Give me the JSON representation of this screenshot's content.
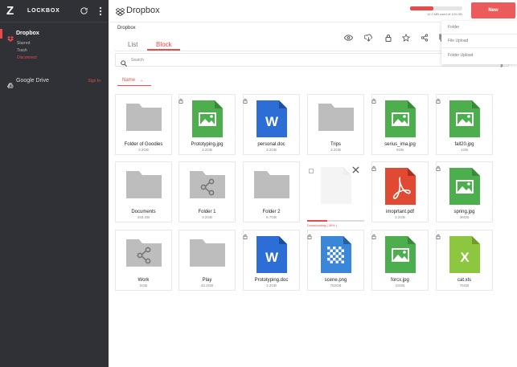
{
  "app": {
    "logo_letter": "Z",
    "brand": "LOCKBOX"
  },
  "sidebar": {
    "accounts": [
      {
        "name": "Dropbox",
        "subitems": [
          "Starred",
          "Trash"
        ],
        "action": "Disconnect"
      },
      {
        "name": "Google Drive",
        "action": "Sign In"
      }
    ]
  },
  "header": {
    "title": "Dropbox",
    "storage_text": "12.2 MB used of 100 GB",
    "storage_fraction": 0.45,
    "new_label": "New"
  },
  "new_menu": {
    "items": [
      "Folder",
      "File Upload",
      "Folder Upload"
    ]
  },
  "breadcrumb": "Dropbox",
  "tabs": [
    {
      "label": "List"
    },
    {
      "label": "Block"
    }
  ],
  "search": {
    "placeholder": "Search"
  },
  "sort": {
    "label": "Name"
  },
  "files": [
    {
      "name": "Folder of Goodies",
      "size": "3.2GB",
      "type": "folder"
    },
    {
      "name": "Prototyping.jpg",
      "size": "3.2GB",
      "type": "image"
    },
    {
      "name": "personal.doc",
      "size": "3.2GB",
      "type": "doc"
    },
    {
      "name": "Trips",
      "size": "3.2GB",
      "type": "folder"
    },
    {
      "name": "serius_ima.jpg",
      "size": "5GB",
      "type": "image"
    },
    {
      "name": "fall20.jpg",
      "size": "1GB",
      "type": "image"
    },
    {
      "name": "Documents",
      "size": "333.GB",
      "type": "folder"
    },
    {
      "name": "Folder 1",
      "size": "3.2GB",
      "type": "shared"
    },
    {
      "name": "Folder 2",
      "size": "6.7GB",
      "type": "folder"
    },
    {
      "name": "imoprtant.pdf",
      "size": "3.2GB",
      "type": "pdf"
    },
    {
      "name": "spring.jpg",
      "size": "36GB",
      "type": "image"
    },
    {
      "name": "Work",
      "size": "5GB",
      "type": "shared"
    },
    {
      "name": "Play",
      "size": "43.2GB",
      "type": "folder"
    },
    {
      "name": "Prototyping.doc",
      "size": "3.2GB",
      "type": "doc"
    },
    {
      "name": "scene.png",
      "size": "762GB",
      "type": "png"
    },
    {
      "name": "forcx.jpg",
      "size": "23GB",
      "type": "image"
    },
    {
      "name": "cat.xls",
      "size": "75GB",
      "type": "xls"
    }
  ],
  "download": {
    "status": "Downloading ( 35% )",
    "progress": 0.35
  },
  "colors": {
    "accent": "#e74c4c",
    "sidebar": "#2f3136",
    "folder": "#bdbdbd",
    "image": "#4cae4c",
    "doc": "#2c6ed5",
    "pdf": "#e04a32",
    "png": "#3a86d8",
    "xls": "#8dc63f"
  }
}
